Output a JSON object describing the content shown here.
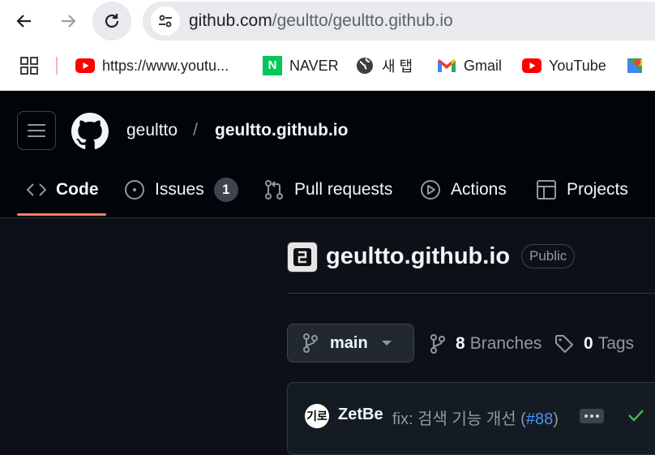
{
  "browser": {
    "url_host": "github.com",
    "url_path": "/geultto/geultto.github.io",
    "bookmarks": [
      {
        "label": "https://www.youtu...",
        "icon": "youtube-icon"
      },
      {
        "label": "NAVER",
        "icon": "naver-icon"
      },
      {
        "label": "새 탭",
        "icon": "globe-icon"
      },
      {
        "label": "Gmail",
        "icon": "gmail-icon"
      },
      {
        "label": "YouTube",
        "icon": "youtube-icon"
      },
      {
        "label": "",
        "icon": "maps-icon"
      }
    ],
    "naver_logo_letter": "N"
  },
  "header": {
    "owner": "geultto",
    "separator": "/",
    "repo": "geultto.github.io",
    "tabs": [
      {
        "label": "Code",
        "icon": "code-icon"
      },
      {
        "label": "Issues",
        "icon": "issue-icon",
        "count": "1"
      },
      {
        "label": "Pull requests",
        "icon": "pull-request-icon"
      },
      {
        "label": "Actions",
        "icon": "play-icon"
      },
      {
        "label": "Projects",
        "icon": "table-icon"
      }
    ]
  },
  "repo": {
    "title": "geultto.github.io",
    "visibility": "Public",
    "branch": "main",
    "branches_count": "8",
    "branches_label": "Branches",
    "tags_count": "0",
    "tags_label": "Tags"
  },
  "commit": {
    "avatar_text": "기로",
    "author": "ZetBe",
    "message": "fix: 검색 기능 개선 (",
    "pr_link": "#88",
    "message_end": ")"
  },
  "colors": {
    "accent_underline": "#f78166",
    "link": "#4493f8",
    "success": "#3fb950"
  }
}
